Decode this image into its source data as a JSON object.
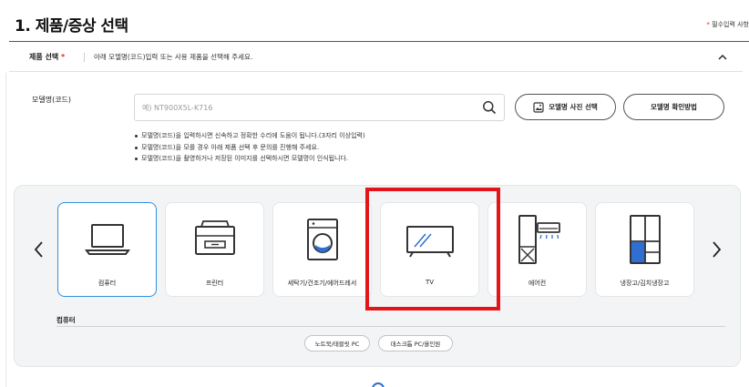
{
  "header": {
    "title": "1. 제품/증상 선택",
    "required_star": "*",
    "required_note": "필수입력 사항"
  },
  "product_select": {
    "label": "제품 선택",
    "star": "*",
    "description": "아래 모델명(코드)입력 또는 사용 제품을 선택해 주세요."
  },
  "model": {
    "label": "모델명(코드)",
    "input_value": "",
    "placeholder": "예) NT900X5L-K716",
    "photo_button": "모델명 사진 선택",
    "howto_button": "모델명 확인방법",
    "notes": [
      "모델명(코드)을 입력하시면 신속하고 정확한 수리에 도움이 됩니다.(3자리 이상입력)",
      "모델명(코드)을 모를 경우 아래 제품 선택 후 문의를 진행해 주세요.",
      "모델명(코드)을 촬영하거나 저장된 이미지를 선택하시면 모델명이 인식됩니다."
    ]
  },
  "products": [
    {
      "label": "컴퓨터",
      "icon": "laptop-icon",
      "selected": true
    },
    {
      "label": "프린터",
      "icon": "printer-icon",
      "selected": false
    },
    {
      "label": "세탁기/건조기/에어드레서",
      "icon": "washer-icon",
      "selected": false
    },
    {
      "label": "TV",
      "icon": "tv-icon",
      "selected": false
    },
    {
      "label": "에어컨",
      "icon": "air-conditioner-icon",
      "selected": false
    },
    {
      "label": "냉장고/김치냉장고",
      "icon": "refrigerator-icon",
      "selected": false
    }
  ],
  "category": {
    "label": "컴퓨터",
    "chips": [
      "노트북/태블릿 PC",
      "데스크톱 PC/올인원"
    ]
  },
  "colors": {
    "accent_blue": "#2e8fe0",
    "highlight_red": "#e3151b",
    "fridge_blue": "#2f6fd0"
  }
}
